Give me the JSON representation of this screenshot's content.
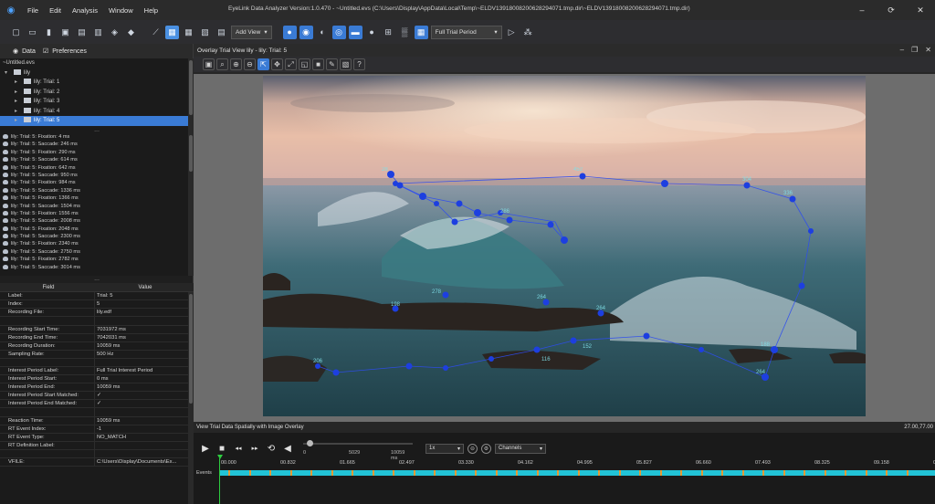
{
  "app": {
    "menus": [
      "File",
      "Edit",
      "Analysis",
      "Window",
      "Help"
    ],
    "title": "EyeLink Data Analyzer Version:1.0.470 - ~Untitled.evs (C:\\Users\\Display\\AppData\\Local\\Temp\\~ELDV13918008200628294071.tmp.dir\\~ELDV13918008200628294071.tmp.dir)",
    "win_controls": [
      "–",
      "⟳",
      "✕"
    ]
  },
  "toolbar": {
    "add_view_label": "Add View",
    "period_label": "Full Trial Period"
  },
  "left_panel": {
    "tabs": [
      {
        "label": "Data"
      },
      {
        "label": "Preferences"
      }
    ],
    "tree": {
      "root": "~Untitled.evs",
      "node": "lily",
      "trials": [
        "lily: Trial: 1",
        "lily: Trial: 2",
        "lily: Trial: 3",
        "lily: Trial: 4",
        "lily: Trial: 5"
      ]
    },
    "events": [
      "lily: Trial: 5: Fixation: 4 ms",
      "lily: Trial: 5: Saccade: 246 ms",
      "lily: Trial: 5: Fixation: 290 ms",
      "lily: Trial: 5: Saccade: 614 ms",
      "lily: Trial: 5: Fixation: 642 ms",
      "lily: Trial: 5: Saccade: 950 ms",
      "lily: Trial: 5: Fixation: 984 ms",
      "lily: Trial: 5: Saccade: 1336 ms",
      "lily: Trial: 5: Fixation: 1366 ms",
      "lily: Trial: 5: Saccade: 1504 ms",
      "lily: Trial: 5: Fixation: 1556 ms",
      "lily: Trial: 5: Saccade: 2008 ms",
      "lily: Trial: 5: Fixation: 2048 ms",
      "lily: Trial: 5: Saccade: 2300 ms",
      "lily: Trial: 5: Fixation: 2340 ms",
      "lily: Trial: 5: Saccade: 2750 ms",
      "lily: Trial: 5: Fixation: 2782 ms",
      "lily: Trial: 5: Saccade: 3014 ms"
    ],
    "props_headers": {
      "field": "Field",
      "value": "Value"
    },
    "props": [
      {
        "field": "Label:",
        "value": "Trial: 5"
      },
      {
        "field": "Index:",
        "value": "5"
      },
      {
        "field": "Recording File:",
        "value": "lily.edf"
      },
      {
        "field": "",
        "value": ""
      },
      {
        "field": "Recording Start Time:",
        "value": "7031972 ms"
      },
      {
        "field": "Recording End Time:",
        "value": "7042031 ms"
      },
      {
        "field": "Recording Duration:",
        "value": "10059 ms"
      },
      {
        "field": "Sampling Rate:",
        "value": "500 Hz"
      },
      {
        "field": "",
        "value": ""
      },
      {
        "field": "Interest Period Label:",
        "value": "Full Trial Interest Period"
      },
      {
        "field": "Interest Period Start:",
        "value": "0 ms"
      },
      {
        "field": "Interest Period End:",
        "value": "10059 ms"
      },
      {
        "field": "Interest Period Start Matched:",
        "value": "✓"
      },
      {
        "field": "Interest Period End Matched:",
        "value": "✓"
      },
      {
        "field": "",
        "value": ""
      },
      {
        "field": "Reaction Time:",
        "value": "10059 ms"
      },
      {
        "field": "RT Event Index:",
        "value": "-1"
      },
      {
        "field": "RT Event Type:",
        "value": "NO_MATCH"
      },
      {
        "field": "RT Definition Label:",
        "value": ""
      },
      {
        "field": "",
        "value": ""
      },
      {
        "field": "VFILE:",
        "value": "C:\\Users\\Display\\Documents\\Ex..."
      }
    ]
  },
  "view": {
    "title": "Overlay Trial View lily - lily: Trial: 5",
    "status_label": "View Trial Data Spatially with Image Overlay",
    "coords": "27.00,77.00"
  },
  "timeline": {
    "slider_labels": [
      "0",
      "5029",
      "10059 ms"
    ],
    "speed": "1x",
    "channels_label": "Channels",
    "ticks": [
      "00.000",
      "00.832",
      "01.665",
      "02.497",
      "03.330",
      "04.162",
      "04.995",
      "05.827",
      "06.660",
      "07.493",
      "08.325",
      "09.158",
      "09.990"
    ],
    "events_label": "Events"
  },
  "colors": {
    "accent": "#3a7bd5",
    "events_bar": "#22c3d6",
    "event_mark": "#e39a36",
    "playhead": "#2ecc40",
    "fixation": "#1d3fe0"
  }
}
